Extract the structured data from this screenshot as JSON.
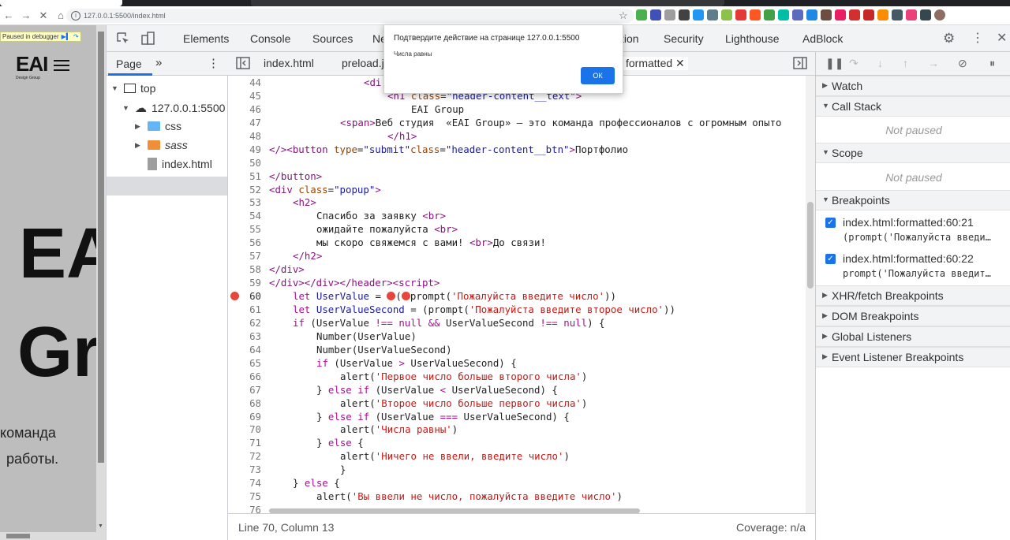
{
  "browser": {
    "url": "127.0.0.1:5500/index.html"
  },
  "page": {
    "paused_label": "Paused in debugger",
    "logo": "EAI",
    "logo_sub": "Design Group",
    "big1": "EA",
    "big2": "Gr",
    "text1": "команда",
    "text2": "работы."
  },
  "devtools": {
    "tabs": [
      "Elements",
      "Console",
      "Sources",
      "Ne",
      "tion",
      "Security",
      "Lighthouse",
      "AdBlock"
    ],
    "left_tab": "Page",
    "tree": {
      "top": "top",
      "host": "127.0.0.1:5500",
      "css": "css",
      "sass": "sass",
      "file": "index.html"
    },
    "editor_tabs": [
      "index.html",
      "preload.j",
      "formatted"
    ],
    "status_left": "Line 70, Column 13",
    "status_right": "Coverage: n/a"
  },
  "code": [
    {
      "n": "44",
      "html": "<span class=\"tag\">&lt;di</span>",
      "indent": 16
    },
    {
      "n": "45",
      "html": "<span class=\"tag\">&lt;h1</span> <span class=\"at\">class</span>=<span class=\"av\">\"header-content__text\"</span><span class=\"tag\">&gt;</span>",
      "indent": 20
    },
    {
      "n": "46",
      "html": "EAI Group",
      "indent": 24
    },
    {
      "n": "47",
      "html": "<span class=\"tag\">&lt;span&gt;</span>Веб студия  «EAI Group» — это команда профессионалов с огромным опыто",
      "indent": 12
    },
    {
      "n": "48",
      "html": "<span class=\"tag\">&lt;/h1&gt;</span>",
      "indent": 20
    },
    {
      "n": "49",
      "html": "<span class=\"tag\">&lt;/&gt;&lt;button</span> <span class=\"at\">type</span>=<span class=\"av\">\"submit\"</span><span class=\"at\">class</span>=<span class=\"av\">\"header-content__btn\"</span><span class=\"tag\">&gt;</span>Портфолио",
      "indent": 0
    },
    {
      "n": "50",
      "html": "",
      "indent": 0
    },
    {
      "n": "51",
      "html": "<span class=\"tag\">&lt;/button&gt;</span>",
      "indent": 0
    },
    {
      "n": "52",
      "html": "<span class=\"tag\">&lt;div</span> <span class=\"at\">class</span>=<span class=\"av\">\"popup\"</span><span class=\"tag\">&gt;</span>",
      "indent": 0
    },
    {
      "n": "53",
      "html": "<span class=\"tag\">&lt;h2&gt;</span>",
      "indent": 4
    },
    {
      "n": "54",
      "html": "Спасибо за заявку <span class=\"tag\">&lt;br&gt;</span>",
      "indent": 8
    },
    {
      "n": "55",
      "html": "ожидайте пожалуйста <span class=\"tag\">&lt;br&gt;</span>",
      "indent": 8
    },
    {
      "n": "56",
      "html": "мы скоро свяжемся с вами! <span class=\"tag\">&lt;br&gt;</span>До связи!",
      "indent": 8
    },
    {
      "n": "57",
      "html": "<span class=\"tag\">&lt;/h2&gt;</span>",
      "indent": 4
    },
    {
      "n": "58",
      "html": "<span class=\"tag\">&lt;/div&gt;</span>",
      "indent": 0
    },
    {
      "n": "59",
      "html": "<span class=\"tag\">&lt;/div&gt;&lt;/div&gt;&lt;/header&gt;&lt;script&gt;</span>",
      "indent": 0
    },
    {
      "n": "60",
      "html": "<span class=\"kw\">let</span> <span class=\"var\">UserValue</span> = <span class=\"dot\"></span>(<span class=\"dot\"></span>prompt(<span class=\"str\">'Пожалуйста введите число'</span>))",
      "indent": 4
    },
    {
      "n": "61",
      "html": "<span class=\"kw\">let</span> <span class=\"var\">UserValueSecond</span> = (prompt(<span class=\"str\">'Пожалуйста введите второе число'</span>))",
      "indent": 4
    },
    {
      "n": "62",
      "html": "<span class=\"kw\">if</span> (UserValue <span class=\"kw\">!==</span> <span class=\"kw\">null</span> <span class=\"kw\">&amp;&amp;</span> UserValueSecond <span class=\"kw\">!==</span> <span class=\"kw\">null</span>) {",
      "indent": 4
    },
    {
      "n": "63",
      "html": "Number(UserValue)",
      "indent": 8
    },
    {
      "n": "64",
      "html": "Number(UserValueSecond)",
      "indent": 8
    },
    {
      "n": "65",
      "html": "<span class=\"kw\">if</span> (UserValue <span class=\"kw\">&gt;</span> UserValueSecond) {",
      "indent": 8
    },
    {
      "n": "66",
      "html": "alert(<span class=\"str\">'Первое число больше второго числа'</span>)",
      "indent": 12
    },
    {
      "n": "67",
      "html": "} <span class=\"kw\">else if</span> (UserValue <span class=\"kw\">&lt;</span> UserValueSecond) {",
      "indent": 8
    },
    {
      "n": "68",
      "html": "alert(<span class=\"str\">'Второе число больше первого числа'</span>)",
      "indent": 12
    },
    {
      "n": "69",
      "html": "} <span class=\"kw\">else if</span> (UserValue <span class=\"kw\">===</span> UserValueSecond) {",
      "indent": 8
    },
    {
      "n": "70",
      "html": "alert(<span class=\"str\">'Числа равны'</span>)",
      "indent": 12
    },
    {
      "n": "71",
      "html": "} <span class=\"kw\">else</span> {",
      "indent": 8
    },
    {
      "n": "72",
      "html": "alert(<span class=\"str\">'Ничего не ввели, введите число'</span>)",
      "indent": 12
    },
    {
      "n": "73",
      "html": "}",
      "indent": 12
    },
    {
      "n": "74",
      "html": "} <span class=\"kw\">else</span> {",
      "indent": 4
    },
    {
      "n": "75",
      "html": "alert(<span class=\"str\">'Вы ввели не число, пожалуйста введите число'</span>)",
      "indent": 8
    },
    {
      "n": "76",
      "html": "",
      "indent": 0
    }
  ],
  "right": {
    "watch": "Watch",
    "callstack": "Call Stack",
    "not_paused": "Not paused",
    "scope": "Scope",
    "breakpoints": "Breakpoints",
    "bp1_file": "index.html:formatted:60:21",
    "bp1_code": "(prompt('Пожалуйста введи…",
    "bp2_file": "index.html:formatted:60:22",
    "bp2_code": "prompt('Пожалуйста введит…",
    "xhr": "XHR/fetch Breakpoints",
    "dom": "DOM Breakpoints",
    "global": "Global Listeners",
    "event": "Event Listener Breakpoints"
  },
  "dialog": {
    "title": "Подтвердите действие на странице 127.0.0.1:5500",
    "message": "Числа равны",
    "ok": "ОК"
  }
}
